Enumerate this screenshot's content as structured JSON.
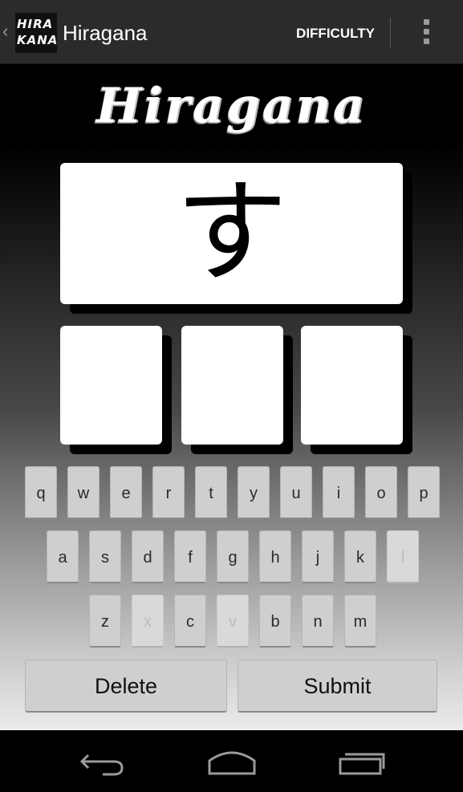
{
  "action_bar": {
    "logo_line1": "HIRA",
    "logo_line2": "KANA",
    "title": "Hiragana",
    "difficulty_label": "DIFFICULTY",
    "overflow_icon": "overflow-menu-icon"
  },
  "game": {
    "logo_text": "Hiragana",
    "current_character": "す",
    "answer_slots": [
      "",
      "",
      ""
    ]
  },
  "keyboard": {
    "row1": [
      {
        "label": "q",
        "enabled": true
      },
      {
        "label": "w",
        "enabled": true
      },
      {
        "label": "e",
        "enabled": true
      },
      {
        "label": "r",
        "enabled": true
      },
      {
        "label": "t",
        "enabled": true
      },
      {
        "label": "y",
        "enabled": true
      },
      {
        "label": "u",
        "enabled": true
      },
      {
        "label": "i",
        "enabled": true
      },
      {
        "label": "o",
        "enabled": true
      },
      {
        "label": "p",
        "enabled": true
      }
    ],
    "row2": [
      {
        "label": "a",
        "enabled": true
      },
      {
        "label": "s",
        "enabled": true
      },
      {
        "label": "d",
        "enabled": true
      },
      {
        "label": "f",
        "enabled": true
      },
      {
        "label": "g",
        "enabled": true
      },
      {
        "label": "h",
        "enabled": true
      },
      {
        "label": "j",
        "enabled": true
      },
      {
        "label": "k",
        "enabled": true
      },
      {
        "label": "l",
        "enabled": false
      }
    ],
    "row3": [
      {
        "label": "z",
        "enabled": true
      },
      {
        "label": "x",
        "enabled": false
      },
      {
        "label": "c",
        "enabled": true
      },
      {
        "label": "v",
        "enabled": false
      },
      {
        "label": "b",
        "enabled": true
      },
      {
        "label": "n",
        "enabled": true
      },
      {
        "label": "m",
        "enabled": true
      }
    ],
    "delete_label": "Delete",
    "submit_label": "Submit"
  },
  "nav_bar": {
    "back_icon": "back-icon",
    "home_icon": "home-icon",
    "recents_icon": "recent-apps-icon"
  }
}
